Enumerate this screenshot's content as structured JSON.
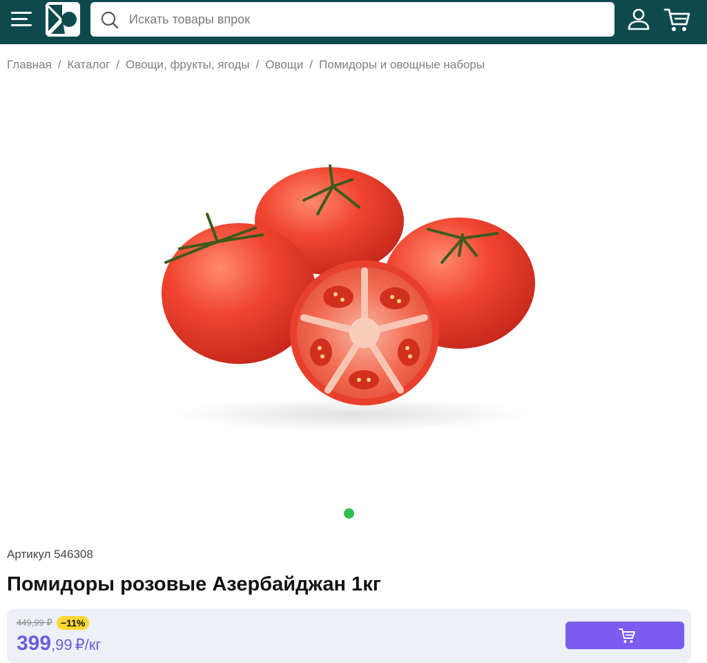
{
  "header": {
    "search_placeholder": "Искать товары впрок",
    "icons": [
      "menu-icon",
      "logo",
      "search-icon",
      "user-icon",
      "cart-icon"
    ],
    "colors": {
      "background": "#0e4a4d",
      "search_bg": "#ffffff"
    }
  },
  "breadcrumb": [
    {
      "label": "Главная"
    },
    {
      "label": "Каталог"
    },
    {
      "label": "Овощи, фрукты, ягоды"
    },
    {
      "label": "Овощи"
    },
    {
      "label": "Помидоры и овощные наборы"
    }
  ],
  "breadcrumb_separator": "/",
  "gallery": {
    "image": "tomatoes-image",
    "active_dot_color": "#2fbf4d"
  },
  "product": {
    "sku_label": "Артикул 546308",
    "title": "Помидоры розовые Азербайджан 1кг"
  },
  "price": {
    "old": "449,99 ₽",
    "discount": "−11%",
    "current_int": "399",
    "current_frac": ",99",
    "unit": "₽/кг",
    "colors": {
      "price": "#6f5bdc",
      "discount_bg": "#ffd733",
      "button": "#7a5cf0",
      "box_bg": "#edf0f6"
    }
  }
}
